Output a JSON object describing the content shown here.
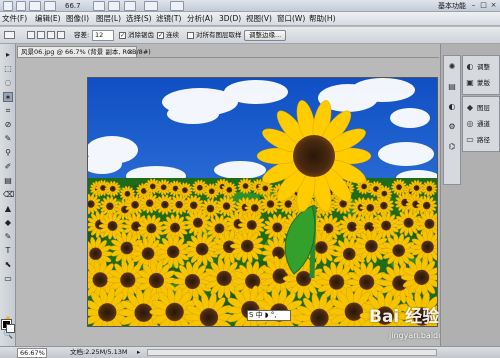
{
  "appbar": {
    "zoom": "66.7",
    "workspace": "基本功能",
    "minimize": "–",
    "maximize": "□",
    "close": "×"
  },
  "menu": [
    "文件(F)",
    "编辑(E)",
    "图像(I)",
    "图层(L)",
    "选择(S)",
    "滤镜(T)",
    "分析(A)",
    "3D(D)",
    "视图(V)",
    "窗口(W)",
    "帮助(H)"
  ],
  "options": {
    "tolerance_label": "容差:",
    "tolerance_value": "12",
    "antialias_label": "消除锯齿",
    "contiguous_label": "连续",
    "all_layers_label": "对所有图层取样",
    "refine_edge_button": "调整边缘..."
  },
  "document": {
    "tab_title": "风景06.jpg @ 66.7% (背景 副本, RGB/8#)",
    "tab_close": "×"
  },
  "tools": {
    "glyphs": [
      "▸",
      "⬚",
      "◌",
      "✶",
      "⌗",
      "⊘",
      "✎",
      "⚲",
      "✐",
      "▤",
      "⌫",
      "▲",
      "◆",
      "✎",
      "T",
      "⬉",
      "▭",
      "✋",
      "🔍"
    ]
  },
  "right_panel": {
    "group1_icons": [
      "✺",
      "▤",
      "◐",
      "⚙",
      "⌬"
    ],
    "group2": [
      {
        "icon": "◐",
        "label": "调整"
      },
      {
        "icon": "▣",
        "label": "蒙版"
      }
    ],
    "group3": [
      {
        "icon": "◆",
        "label": "图层"
      },
      {
        "icon": "◎",
        "label": "通道"
      },
      {
        "icon": "▭",
        "label": "路径"
      }
    ]
  },
  "status": {
    "zoom": "66.67%",
    "doc_info": "文档:2.25M/5.13M",
    "arrow": "▸"
  },
  "ime": {
    "text": "S 中 ◗ °,"
  },
  "watermark": {
    "text": "Bai 经验",
    "url": "jingyan.baidu.com"
  },
  "colors": {
    "sky": "#1a66d9",
    "petal": "#f7c400",
    "leaf": "#1f7a1f",
    "selection_blue": "#9aa6b6"
  }
}
